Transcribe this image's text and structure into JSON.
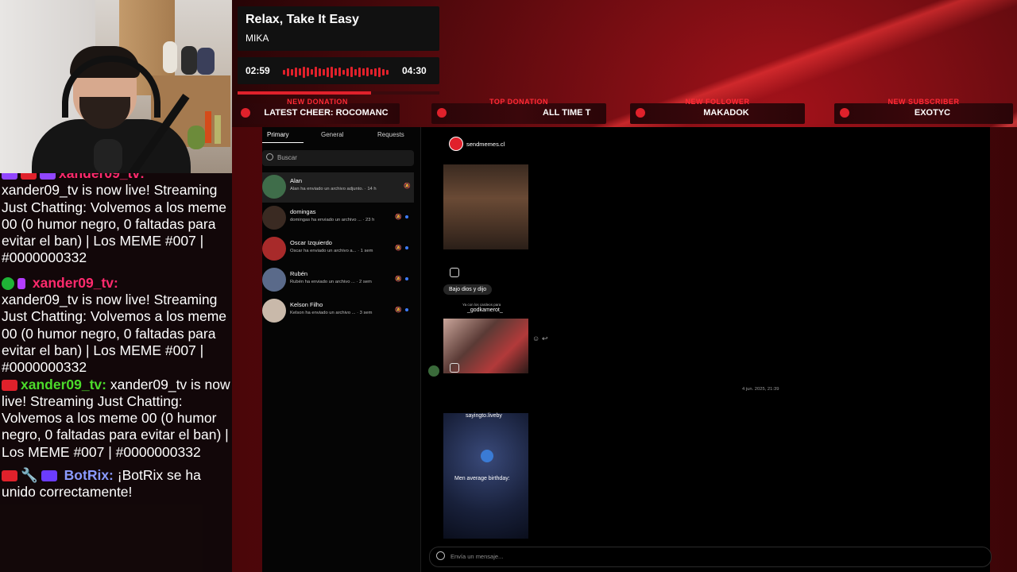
{
  "now_playing": {
    "title": "Relax, Take It Easy",
    "artist": "MIKA",
    "current_time": "02:59",
    "duration": "04:30",
    "progress": 0.66
  },
  "alerts": [
    {
      "label": "NEW DONATION",
      "value": "LATEST CHEER: ROCOMANC"
    },
    {
      "label": "TOP DONATION",
      "value": "ALL TIME T"
    },
    {
      "label": "NEW FOLLOWER",
      "value": "MAKADOK"
    },
    {
      "label": "NEW SUBSCRIBER",
      "value": "EXOTYC"
    }
  ],
  "chat": {
    "top_name": "xander09_tv:",
    "messages": [
      {
        "name": "",
        "text": "xander09_tv is now live! Streaming Just Chatting: Volvemos a los meme 00 (0 humor negro, 0 faltadas para evitar el ban) | Los MEME #007 | #0000000332",
        "name_color": "#ff2a6d"
      },
      {
        "name": "xander09_tv:",
        "text": "xander09_tv is now live! Streaming Just Chatting: Volvemos a los meme 00 (0 humor negro, 0 faltadas para evitar el ban) | Los MEME #007 | #0000000332",
        "name_color": "#ff2a6d"
      },
      {
        "name": "xander09_tv:",
        "text": "xander09_tv is now live! Streaming Just Chatting: Volvemos a los meme 00 (0 humor negro, 0 faltadas para evitar el ban) | Los MEME #007 | #0000000332",
        "name_color": "#4cdb2a"
      },
      {
        "name": "BotRix:",
        "text": "¡BotRix se ha unido correctamente!",
        "name_color": "#8a9bff"
      }
    ]
  },
  "instagram": {
    "tabs": [
      "Primary",
      "General",
      "Requests"
    ],
    "search_placeholder": "Buscar",
    "conversations": [
      {
        "name": "Alan",
        "preview": "Alan ha enviado un archivo adjunto. · 14 h",
        "avatar_color": "#3f6d4a",
        "selected": true
      },
      {
        "name": "domingas",
        "preview": "domingas ha enviado un archivo ... · 23 h",
        "avatar_color": "#3a2a22",
        "selected": false
      },
      {
        "name": "Oscar Izquierdo",
        "preview": "Oscar ha enviado un archivo a... · 1 sem",
        "avatar_color": "#a82a2a",
        "selected": false
      },
      {
        "name": "Rubén",
        "preview": "Rubén ha enviado un archivo ... · 2 sem",
        "avatar_color": "#5a6a8a",
        "selected": false
      },
      {
        "name": "Kelson Filho",
        "preview": "Kelson ha enviado un archivo ... · 3 sem",
        "avatar_color": "#c9b9aa",
        "selected": false
      }
    ],
    "thread": {
      "name": "sendmemes.cl",
      "bubble_text": "Bajo dios y dijo",
      "shared_sub": "Ya con los cardeos para",
      "shared_user": "_godkamerot_",
      "date": "4 jun. 2025, 21:39",
      "saying_user": "sayingto.liveby",
      "meme_caption": "Men average birthday:",
      "message_placeholder": "Envía un mensaje..."
    }
  }
}
